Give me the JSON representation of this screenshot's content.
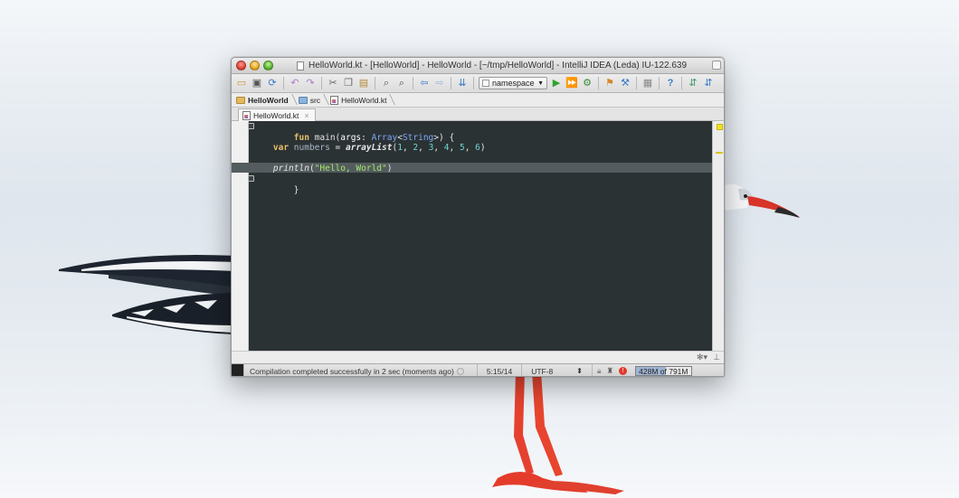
{
  "window": {
    "title": "HelloWorld.kt - [HelloWorld] - HelloWorld - [~/tmp/HelloWorld] - IntelliJ IDEA (Leda) IU-122.639"
  },
  "toolbar": {
    "run_config": "namespace"
  },
  "breadcrumb": {
    "items": [
      "HelloWorld",
      "src",
      "HelloWorld.kt"
    ]
  },
  "editor_tab": {
    "label": "HelloWorld.kt",
    "close": "×"
  },
  "code": {
    "line1": {
      "kw": "fun",
      "name": " main(",
      "param": "args",
      "colon": ": ",
      "type1": "Array",
      "lt": "<",
      "type2": "String",
      "rest": ">) {"
    },
    "line2": {
      "kw": "var",
      "var": " numbers",
      "eq": " = ",
      "fn": "arrayList",
      "open": "(",
      "n1": "1",
      "c1": ", ",
      "n2": "2",
      "c2": ", ",
      "n3": "3",
      "c3": ", ",
      "n4": "4",
      "c4": ", ",
      "n5": "5",
      "c5": ", ",
      "n6": "6",
      "close": ")"
    },
    "line3": {
      "fn": "println",
      "open": "(",
      "str": "\"Hello, World\"",
      "close": ")"
    },
    "line4": "}"
  },
  "status": {
    "message": "Compilation completed successfully in 2 sec (moments ago)",
    "position": "5:15/14",
    "encoding": "UTF-8",
    "encoding_arrow": "⬍",
    "memory": "428M of 791M",
    "memory_fraction": 0.54
  },
  "bottom_tools": {
    "gear": "✻▾",
    "pin": "⊥"
  },
  "colors": {
    "editor_bg": "#2b3234",
    "keyword": "#e8bf6a",
    "type": "#7ea6f5",
    "number": "#6fd2d2",
    "string": "#a5e66a"
  }
}
